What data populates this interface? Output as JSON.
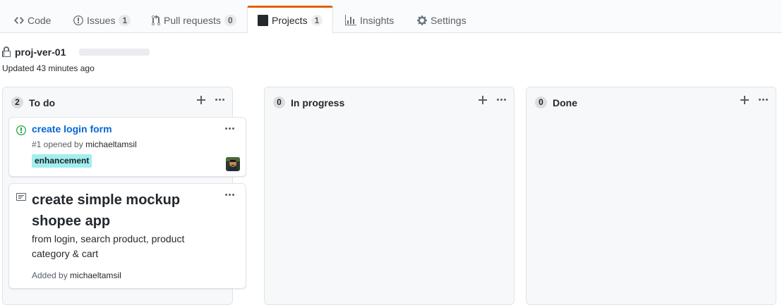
{
  "tabs": [
    {
      "label": "Code",
      "icon": "code-icon",
      "count": null,
      "selected": false
    },
    {
      "label": "Issues",
      "icon": "issue-opened-icon",
      "count": "1",
      "selected": false
    },
    {
      "label": "Pull requests",
      "icon": "git-pull-request-icon",
      "count": "0",
      "selected": false
    },
    {
      "label": "Projects",
      "icon": "project-icon",
      "count": "1",
      "selected": true
    },
    {
      "label": "Insights",
      "icon": "graph-icon",
      "count": null,
      "selected": false
    },
    {
      "label": "Settings",
      "icon": "gear-icon",
      "count": null,
      "selected": false
    }
  ],
  "project": {
    "name": "proj-ver-01",
    "updated": "Updated 43 minutes ago",
    "icon": "lock-icon"
  },
  "columns": [
    {
      "name": "To do",
      "count": "2"
    },
    {
      "name": "In progress",
      "count": "0"
    },
    {
      "name": "Done",
      "count": "0"
    }
  ],
  "cards": {
    "issue": {
      "title": "create login form",
      "number_prefix": "#1 opened by ",
      "author": "michaeltamsil",
      "label": "enhancement",
      "label_color": "#84b6eb",
      "label_bg": "#a2eeef",
      "status_color": "#28a745"
    },
    "note": {
      "title": "create simple mockup shopee app",
      "body": "from login, search product, product category & cart",
      "added_prefix": "Added by ",
      "author": "michaeltamsil"
    }
  },
  "colors": {
    "accent_tab": "#e36209",
    "link": "#0366d6"
  }
}
